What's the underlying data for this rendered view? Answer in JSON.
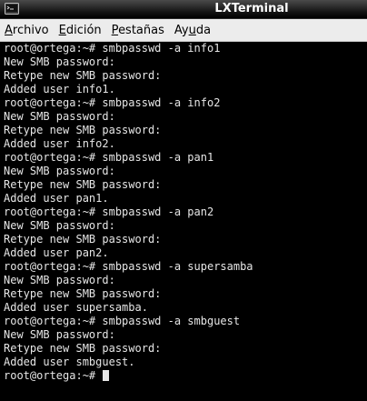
{
  "window": {
    "title": "LXTerminal",
    "icon": "terminal-icon"
  },
  "menu": [
    {
      "label": "Archivo",
      "underline": "A",
      "rest": "rchivo"
    },
    {
      "label": "Edición",
      "underline": "E",
      "rest": "dición"
    },
    {
      "label": "Pestañas",
      "underline": "P",
      "rest": "estañas"
    },
    {
      "label": "Ayuda",
      "underline_pre": "Ay",
      "underline": "u",
      "rest": "da"
    }
  ],
  "colors": {
    "terminal_bg": "#000000",
    "terminal_fg": "#e6e6e6",
    "menubar_bg": "#ececec",
    "titlebar_fg": "#ffffff"
  },
  "terminal": {
    "lines": [
      "root@ortega:~# smbpasswd -a info1",
      "New SMB password:",
      "Retype new SMB password:",
      "Added user info1.",
      "root@ortega:~# smbpasswd -a info2",
      "New SMB password:",
      "Retype new SMB password:",
      "Added user info2.",
      "root@ortega:~# smbpasswd -a pan1",
      "New SMB password:",
      "Retype new SMB password:",
      "Added user pan1.",
      "root@ortega:~# smbpasswd -a pan2",
      "New SMB password:",
      "Retype new SMB password:",
      "Added user pan2.",
      "root@ortega:~# smbpasswd -a supersamba",
      "New SMB password:",
      "Retype new SMB password:",
      "Added user supersamba.",
      "root@ortega:~# smbpasswd -a smbguest",
      "New SMB password:",
      "Retype new SMB password:",
      "Added user smbguest."
    ],
    "prompt": "root@ortega:~# "
  }
}
